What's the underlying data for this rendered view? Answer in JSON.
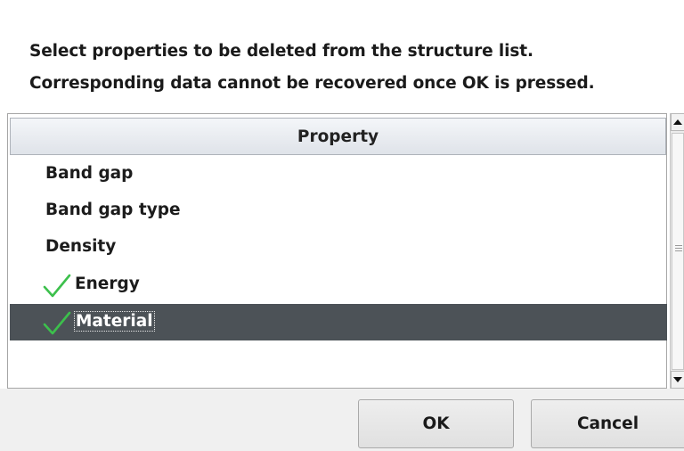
{
  "message": {
    "line1": "Select properties to be deleted from the structure list.",
    "line2": "Corresponding data cannot be recovered once OK is pressed."
  },
  "list": {
    "header": "Property",
    "rows": [
      {
        "label": "Band gap",
        "checked": false,
        "selected": false
      },
      {
        "label": "Band gap type",
        "checked": false,
        "selected": false
      },
      {
        "label": "Density",
        "checked": false,
        "selected": false
      },
      {
        "label": "Energy",
        "checked": true,
        "selected": false
      },
      {
        "label": "Material",
        "checked": true,
        "selected": true
      }
    ]
  },
  "buttons": {
    "ok_label": "OK",
    "cancel_label": "Cancel"
  },
  "colors": {
    "selection": "#4c5257",
    "check": "#3cc04c"
  },
  "icons": {
    "check": "checkmark-icon",
    "scroll_up": "arrow-up-icon",
    "scroll_down": "arrow-down-icon"
  }
}
